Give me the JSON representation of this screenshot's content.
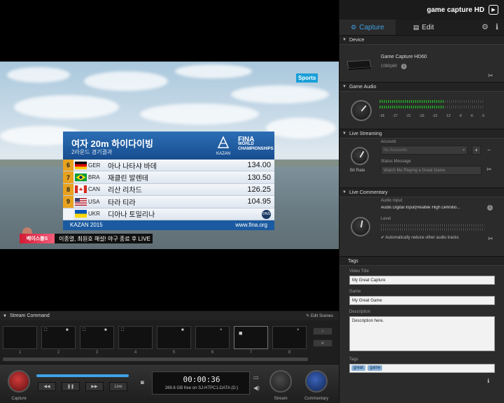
{
  "app": {
    "brand": "game capture HD"
  },
  "tabs": [
    {
      "label": "Capture",
      "icon": "capture-icon",
      "active": true
    },
    {
      "label": "Edit",
      "icon": "film-icon",
      "active": false
    }
  ],
  "video": {
    "channel_logo": "Sports",
    "scoreboard": {
      "title": "여자 20m 하이다이빙",
      "subtitle": "2라운드 경기결과",
      "org_mark": "KAZAN",
      "org_text_1": "FINA",
      "org_text_2": "WORLD",
      "org_text_3": "CHAMPIONSHIPS",
      "rows": [
        {
          "rank": "6",
          "country": "GER",
          "name": "아나 나타샤 바데",
          "score": "134.00"
        },
        {
          "rank": "7",
          "country": "BRA",
          "name": "재클린 발렌테",
          "score": "130.50"
        },
        {
          "rank": "8",
          "country": "CAN",
          "name": "리산 리차드",
          "score": "126.25"
        },
        {
          "rank": "9",
          "country": "USA",
          "name": "타라 티라",
          "score": "104.95"
        },
        {
          "rank": "",
          "country": "UKR",
          "name": "디아나 토밀리나",
          "score": "",
          "badge": "DNS"
        }
      ],
      "footer_left": "KAZAN 2015",
      "footer_right": "www.fina.org"
    },
    "ticker": {
      "badge": "베이스볼S",
      "text": "이종열, 최원호 해설! 야구 종료 후 LIVE"
    }
  },
  "panel": {
    "device": {
      "header": "Device",
      "name": "Game Capture HD60",
      "resolution": "1080p60"
    },
    "game_audio": {
      "header": "Game Audio",
      "ticks": [
        "-36",
        "-27",
        "-21",
        "-18",
        "-15",
        "-12",
        "-9",
        "-6",
        "-3"
      ]
    },
    "live_streaming": {
      "header": "Live Streaming",
      "account_label": "Account",
      "account_value": "No Accounts",
      "status_label": "Status Message",
      "status_placeholder": "Watch Me Playing a Great Game",
      "bitrate_label": "Bit Rate"
    },
    "live_commentary": {
      "header": "Live Commentary",
      "audio_input_label": "Audio Input",
      "audio_input_value": "Audio Digital Input(Realtek High Definitio...",
      "level_label": "Level",
      "auto_reduce_label": "Automatically reduce other audio tracks"
    },
    "tags": {
      "header": "Tags",
      "video_title_label": "Video Title",
      "video_title_value": "My Great Capture",
      "game_label": "Game",
      "game_value": "My Great Game",
      "description_label": "Description",
      "description_value": "Description here.",
      "tags_label": "Tags",
      "tag_items": [
        "great",
        "game"
      ]
    }
  },
  "stream_command": {
    "header": "Stream Command",
    "edit_scenes": "Edit Scenes",
    "scene_numbers": [
      "1",
      "2",
      "3",
      "4",
      "5",
      "6",
      "7",
      "8"
    ]
  },
  "controls": {
    "capture_label": "Capture",
    "live_label": "Live",
    "timecode": "00:00:36",
    "disk_info": "269.8 GB free on SJ-HTPC1-DATA (D:)",
    "stream_label": "Stream",
    "commentary_label": "Commentary"
  }
}
